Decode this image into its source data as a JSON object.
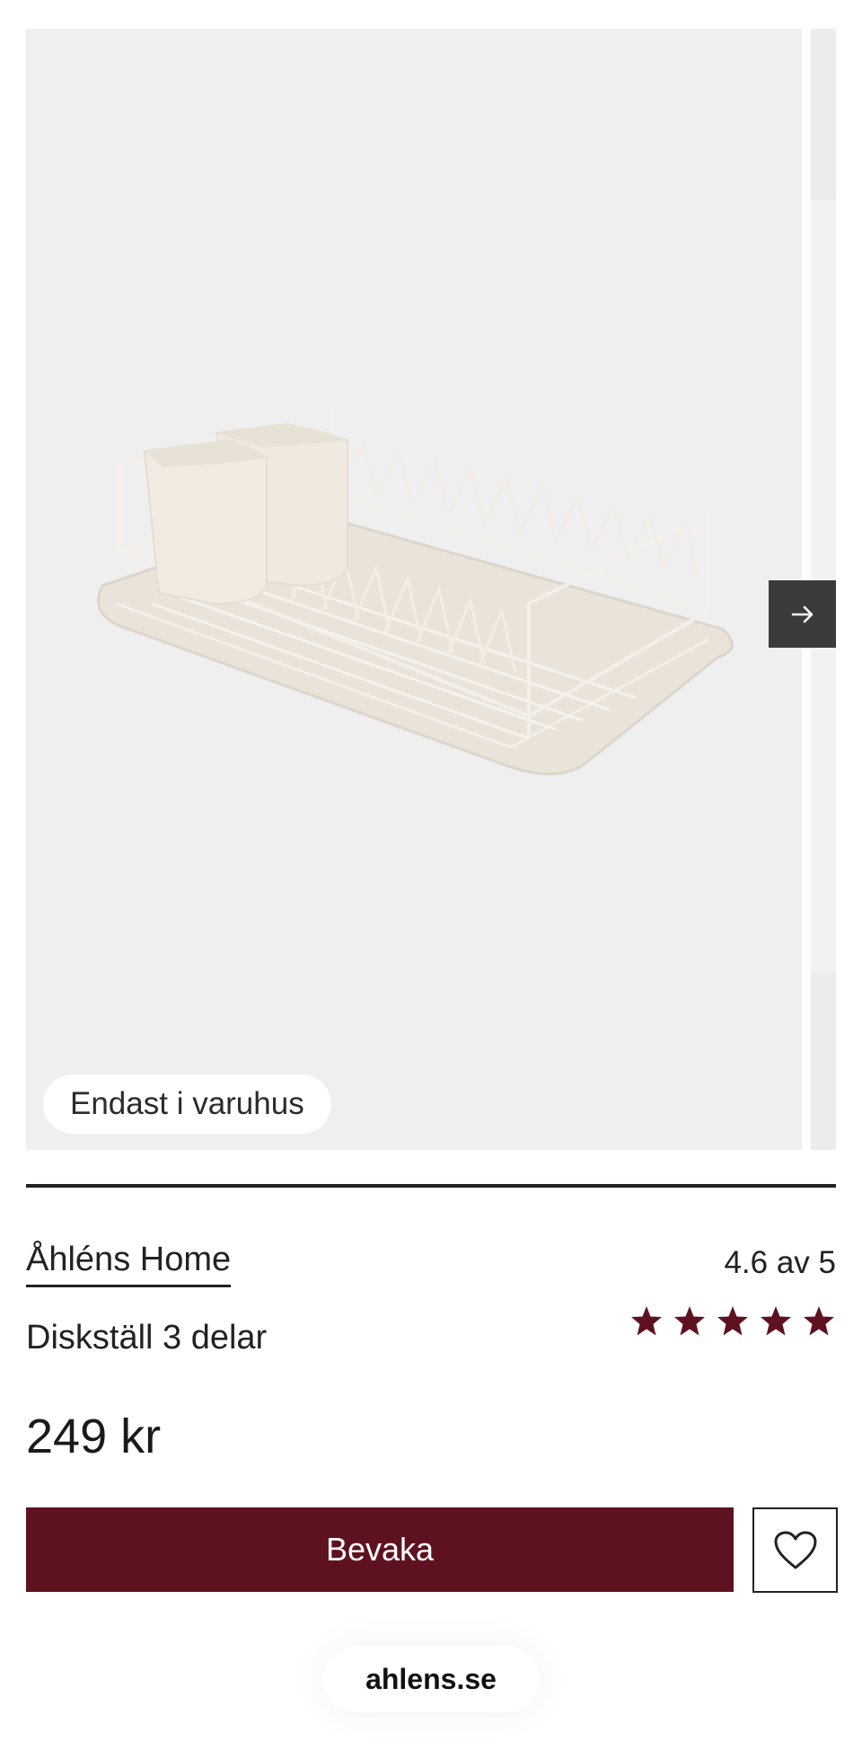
{
  "gallery": {
    "badge_label": "Endast i varuhus",
    "next_icon": "arrow-right-icon",
    "image_description_icon": "dish-rack-image"
  },
  "product": {
    "brand": "Åhléns Home",
    "name": "Diskställ 3 delar",
    "price": "249 kr",
    "rating_text": "4.6 av 5",
    "rating_value": 4.6,
    "rating_max": 5
  },
  "actions": {
    "watch_label": "Bevaka",
    "favorite_icon": "heart-icon"
  },
  "browser": {
    "url": "ahlens.se"
  },
  "colors": {
    "accent": "#5e1220",
    "star": "#5e1220",
    "image_bg": "#efefef",
    "next_button_bg": "#3b3b3b"
  }
}
